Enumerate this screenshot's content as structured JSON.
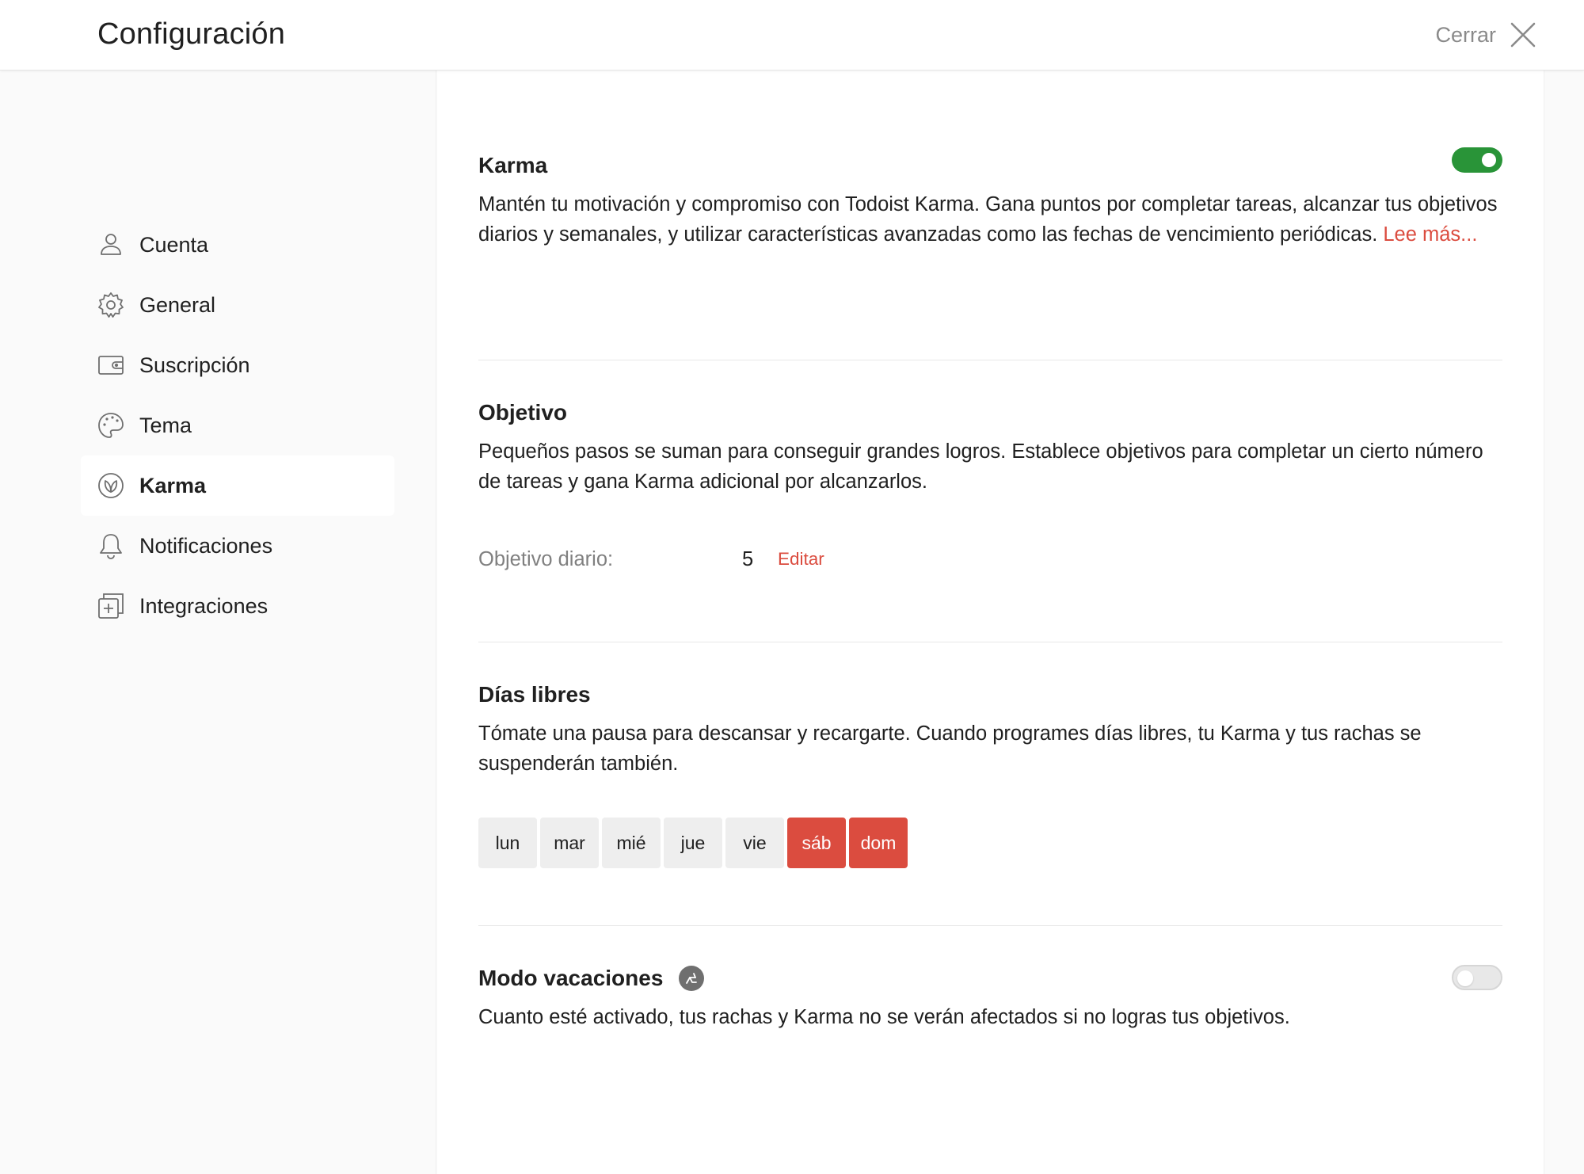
{
  "header": {
    "title": "Configuración",
    "close_label": "Cerrar"
  },
  "sidebar": {
    "items": [
      {
        "label": "Cuenta",
        "icon": "user-icon",
        "active": false
      },
      {
        "label": "General",
        "icon": "gear-icon",
        "active": false
      },
      {
        "label": "Suscripción",
        "icon": "wallet-icon",
        "active": false
      },
      {
        "label": "Tema",
        "icon": "palette-icon",
        "active": false
      },
      {
        "label": "Karma",
        "icon": "karma-icon",
        "active": true
      },
      {
        "label": "Notificaciones",
        "icon": "bell-icon",
        "active": false
      },
      {
        "label": "Integraciones",
        "icon": "integrations-icon",
        "active": false
      }
    ]
  },
  "karma": {
    "title": "Karma",
    "description": "Mantén tu motivación y compromiso con Todoist Karma. Gana puntos por completar tareas, alcanzar tus objetivos diarios y semanales, y utilizar características avanzadas como las fechas de vencimiento periódicas.",
    "link": "Lee más...",
    "enabled": true
  },
  "goals": {
    "title": "Objetivo",
    "description": "Pequeños pasos se suman para conseguir grandes logros. Establece objetivos para completar un cierto número de tareas y gana Karma adicional por alcanzarlos.",
    "daily_label": "Objetivo diario:",
    "daily_value": "5",
    "edit_label": "Editar"
  },
  "days_off": {
    "title": "Días libres",
    "description": "Tómate una pausa para descansar y recargarte. Cuando programes días libres, tu Karma y tus rachas se suspenderán también.",
    "days": [
      {
        "label": "lun",
        "selected": false
      },
      {
        "label": "mar",
        "selected": false
      },
      {
        "label": "mié",
        "selected": false
      },
      {
        "label": "jue",
        "selected": false
      },
      {
        "label": "vie",
        "selected": false
      },
      {
        "label": "sáb",
        "selected": true
      },
      {
        "label": "dom",
        "selected": true
      }
    ]
  },
  "vacation": {
    "title": "Modo vacaciones",
    "description": "Cuanto esté activado, tus rachas y Karma no se verán afectados si no logras tus objetivos.",
    "enabled": false,
    "icon": "beach-chair-icon"
  },
  "colors": {
    "accent": "#db4c3f",
    "toggle_on": "#299438",
    "muted_text": "#808080"
  }
}
